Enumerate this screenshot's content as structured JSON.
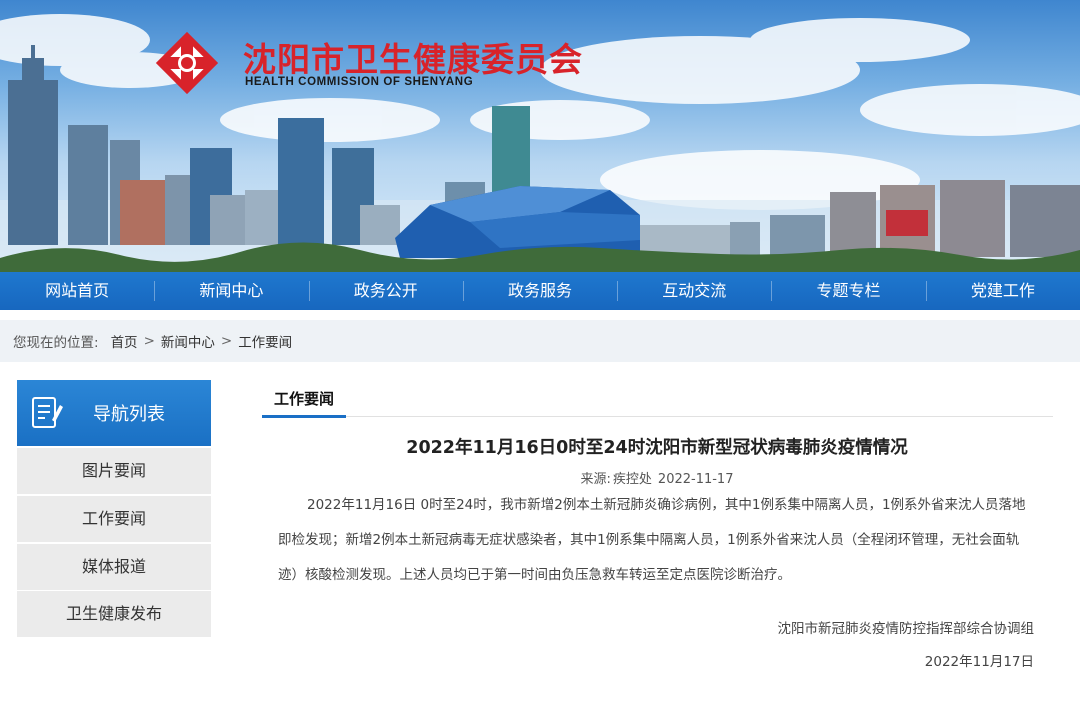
{
  "site": {
    "title": "沈阳市卫生健康委员会",
    "subtitle": "HEALTH COMMISSION OF SHENYANG"
  },
  "nav": {
    "items": [
      "网站首页",
      "新闻中心",
      "政务公开",
      "政务服务",
      "互动交流",
      "专题专栏",
      "党建工作"
    ]
  },
  "breadcrumb": {
    "lead": "您现在的位置:",
    "items": [
      "首页",
      "新闻中心",
      "工作要闻"
    ],
    "separator": ">"
  },
  "sidebar": {
    "title": "导航列表",
    "items": [
      "图片要闻",
      "工作要闻",
      "媒体报道",
      "卫生健康发布"
    ]
  },
  "main": {
    "tab": "工作要闻",
    "article": {
      "title": "2022年11月16日0时至24时沈阳市新型冠状病毒肺炎疫情情况",
      "source_label": "来源:",
      "source": "疾控处",
      "date": "2022-11-17",
      "body": "2022年11月16日 0时至24时，我市新增2例本土新冠肺炎确诊病例，其中1例系集中隔离人员，1例系外省来沈人员落地即检发现；新增2例本土新冠病毒无症状感染者，其中1例系集中隔离人员，1例系外省来沈人员（全程闭环管理，无社会面轨迹）核酸检测发现。上述人员均已于第一时间由负压急救车转运至定点医院诊断治疗。",
      "signature_org": "沈阳市新冠肺炎疫情防控指挥部综合协调组",
      "signature_date": "2022年11月17日"
    }
  },
  "colors": {
    "nav_blue": "#1767bf",
    "brand_red": "#d8232a",
    "sidebar_blue": "#1a70c4",
    "sidebar_item_bg": "#ebebeb",
    "crumb_bg": "#eef2f6"
  },
  "icons": {
    "logo": "health-commission-logo",
    "sidebar_header": "document-list-icon"
  }
}
